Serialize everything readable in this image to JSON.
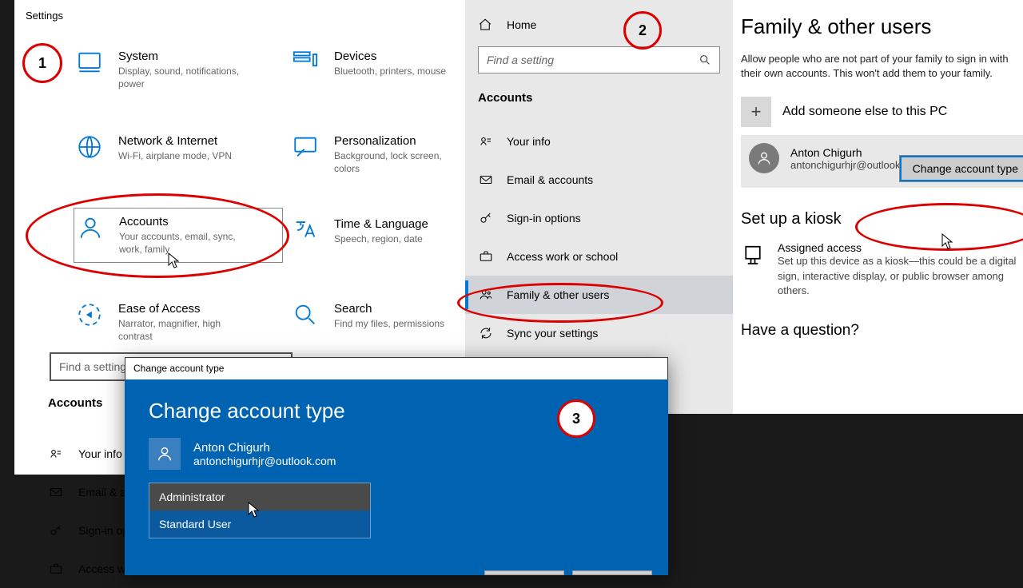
{
  "panel1": {
    "title": "Settings",
    "search_placeholder": "Find a setting",
    "section_title": "Accounts",
    "cats": {
      "system": {
        "h": "System",
        "d": "Display, sound, notifications, power"
      },
      "devices": {
        "h": "Devices",
        "d": "Bluetooth, printers, mouse"
      },
      "network": {
        "h": "Network & Internet",
        "d": "Wi-Fi, airplane mode, VPN"
      },
      "personalization": {
        "h": "Personalization",
        "d": "Background, lock screen, colors"
      },
      "accounts": {
        "h": "Accounts",
        "d": "Your accounts, email, sync, work, family"
      },
      "time": {
        "h": "Time & Language",
        "d": "Speech, region, date"
      },
      "ease": {
        "h": "Ease of Access",
        "d": "Narrator, magnifier, high contrast"
      },
      "search": {
        "h": "Search",
        "d": "Find my files, permissions"
      }
    },
    "nav": {
      "your_info": "Your info",
      "email": "Email & ac",
      "signin": "Sign-in op",
      "access": "Access wo"
    }
  },
  "panel2": {
    "home": "Home",
    "search_placeholder": "Find a setting",
    "section": "Accounts",
    "items": {
      "your_info": "Your info",
      "email": "Email & accounts",
      "signin": "Sign-in options",
      "access": "Access work or school",
      "family": "Family & other users",
      "sync": "Sync your settings"
    }
  },
  "panel3": {
    "heading": "Family & other users",
    "desc": "Allow people who are not part of your family to sign in with their own accounts. This won't add them to your family.",
    "add_label": "Add someone else to this PC",
    "user_name": "Anton Chigurh",
    "user_email": "antonchigurhjr@outlook.com",
    "change_btn": "Change account type",
    "kiosk_heading": "Set up a kiosk",
    "assigned_h": "Assigned access",
    "assigned_d": "Set up this device as a kiosk—this could be a digital sign, interactive display, or public browser among others.",
    "question": "Have a question?"
  },
  "dialog": {
    "titlebar": "Change account type",
    "heading": "Change account type",
    "user_name": "Anton Chigurh",
    "user_email": "antonchigurhjr@outlook.com",
    "opt_admin": "Administrator",
    "opt_standard": "Standard User"
  },
  "annotations": {
    "n1": "1",
    "n2": "2",
    "n3": "3"
  }
}
